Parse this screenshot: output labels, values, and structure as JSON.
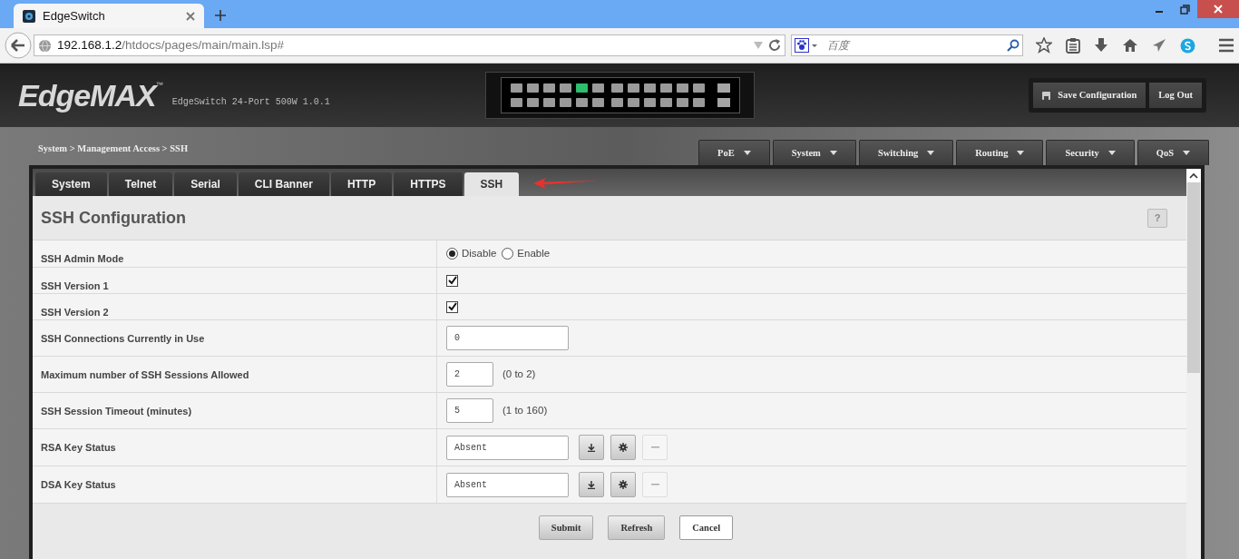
{
  "browser": {
    "tab_title": "EdgeSwitch",
    "url_host": "192.168.1.2",
    "url_path": "/htdocs/pages/main/main.lsp#",
    "search_placeholder": "百度"
  },
  "header": {
    "logo": "EdgeMAX",
    "logo_mark": "™",
    "model": "EdgeSwitch 24-Port 500W 1.0.1",
    "ports": [
      {
        "active": false
      },
      {
        "active": false
      },
      {
        "active": false
      },
      {
        "active": false
      },
      {
        "active": false
      },
      {
        "active": false
      },
      {
        "active": false
      },
      {
        "active": false
      },
      {
        "active": true
      },
      {
        "active": false
      },
      {
        "active": false
      },
      {
        "active": false
      },
      {
        "active": false
      },
      {
        "active": false
      },
      {
        "active": false
      },
      {
        "active": false
      },
      {
        "active": false
      },
      {
        "active": false
      },
      {
        "active": false
      },
      {
        "active": false
      },
      {
        "active": false
      },
      {
        "active": false
      },
      {
        "active": false
      },
      {
        "active": false
      }
    ],
    "sfp_ports": [
      {
        "active": false
      },
      {
        "active": false
      }
    ],
    "buttons": [
      {
        "label": "Save Configuration",
        "kind": "save"
      },
      {
        "label": "Log Out",
        "kind": "plain"
      }
    ]
  },
  "breadcrumb": "System > Management Access > SSH",
  "menu": [
    "PoE",
    "System",
    "Switching",
    "Routing",
    "Security",
    "QoS"
  ],
  "tabs": [
    {
      "label": "System",
      "selected": false
    },
    {
      "label": "Telnet",
      "selected": false
    },
    {
      "label": "Serial",
      "selected": false
    },
    {
      "label": "CLI Banner",
      "selected": false
    },
    {
      "label": "HTTP",
      "selected": false
    },
    {
      "label": "HTTPS",
      "selected": false
    },
    {
      "label": "SSH",
      "selected": true
    }
  ],
  "section": {
    "title": "SSH Configuration",
    "help": "?"
  },
  "rows": [
    {
      "kind": "radio",
      "label": "SSH Admin Mode",
      "options": [
        {
          "label": "Disable",
          "selected": true
        },
        {
          "label": "Enable",
          "selected": false
        }
      ]
    },
    {
      "kind": "checkbox",
      "label": "SSH Version 1",
      "checked": true
    },
    {
      "kind": "checkbox",
      "label": "SSH Version 2",
      "checked": true
    },
    {
      "kind": "text",
      "label": "SSH Connections Currently in Use",
      "value": "0"
    },
    {
      "kind": "number",
      "label": "Maximum number of SSH Sessions Allowed",
      "value": "2",
      "hint": "(0 to 2)"
    },
    {
      "kind": "number",
      "label": "SSH Session Timeout (minutes)",
      "value": "5",
      "hint": "(1 to 160)"
    },
    {
      "kind": "key",
      "label": "RSA Key Status",
      "value": "Absent"
    },
    {
      "kind": "key",
      "label": "DSA Key Status",
      "value": "Absent"
    }
  ],
  "actions": [
    {
      "label": "Submit",
      "kind": "gray"
    },
    {
      "label": "Refresh",
      "kind": "gray"
    },
    {
      "label": "Cancel",
      "kind": "white"
    }
  ]
}
